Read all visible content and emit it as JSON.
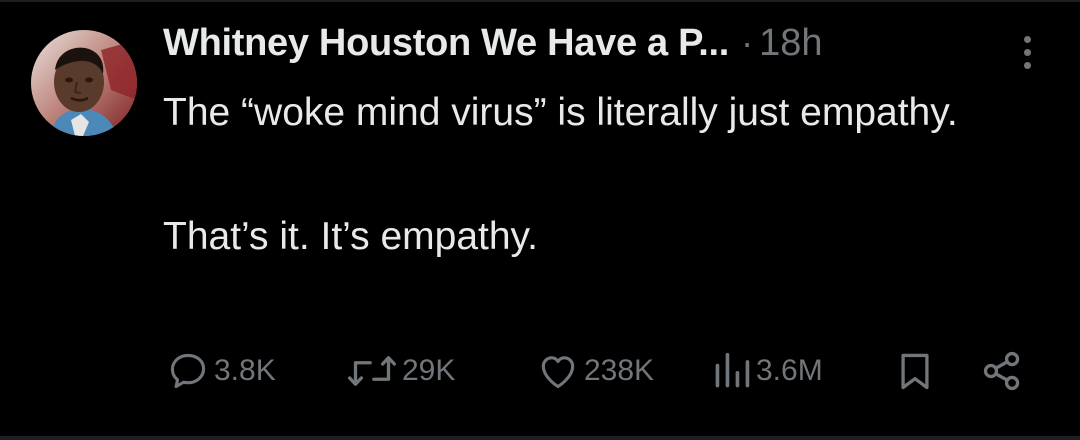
{
  "tweet": {
    "author": {
      "display_name": "Whitney Houston We Have a P...",
      "avatar_icon": "avatar-photo"
    },
    "separator": "·",
    "timestamp": "18h",
    "text_lines": [
      "The “woke mind virus” is literally just empathy.",
      "That’s it. It’s empathy."
    ]
  },
  "actions": {
    "reply": {
      "icon": "reply-icon",
      "count": "3.8K"
    },
    "retweet": {
      "icon": "retweet-icon",
      "count": "29K"
    },
    "like": {
      "icon": "heart-icon",
      "count": "238K"
    },
    "views": {
      "icon": "views-icon",
      "count": "3.6M"
    },
    "bookmark": {
      "icon": "bookmark-icon"
    },
    "share": {
      "icon": "share-icon"
    }
  },
  "colors": {
    "background": "#000000",
    "primary_text": "#e7e9ea",
    "secondary_text": "#71767b",
    "divider": "#1c1f23"
  }
}
